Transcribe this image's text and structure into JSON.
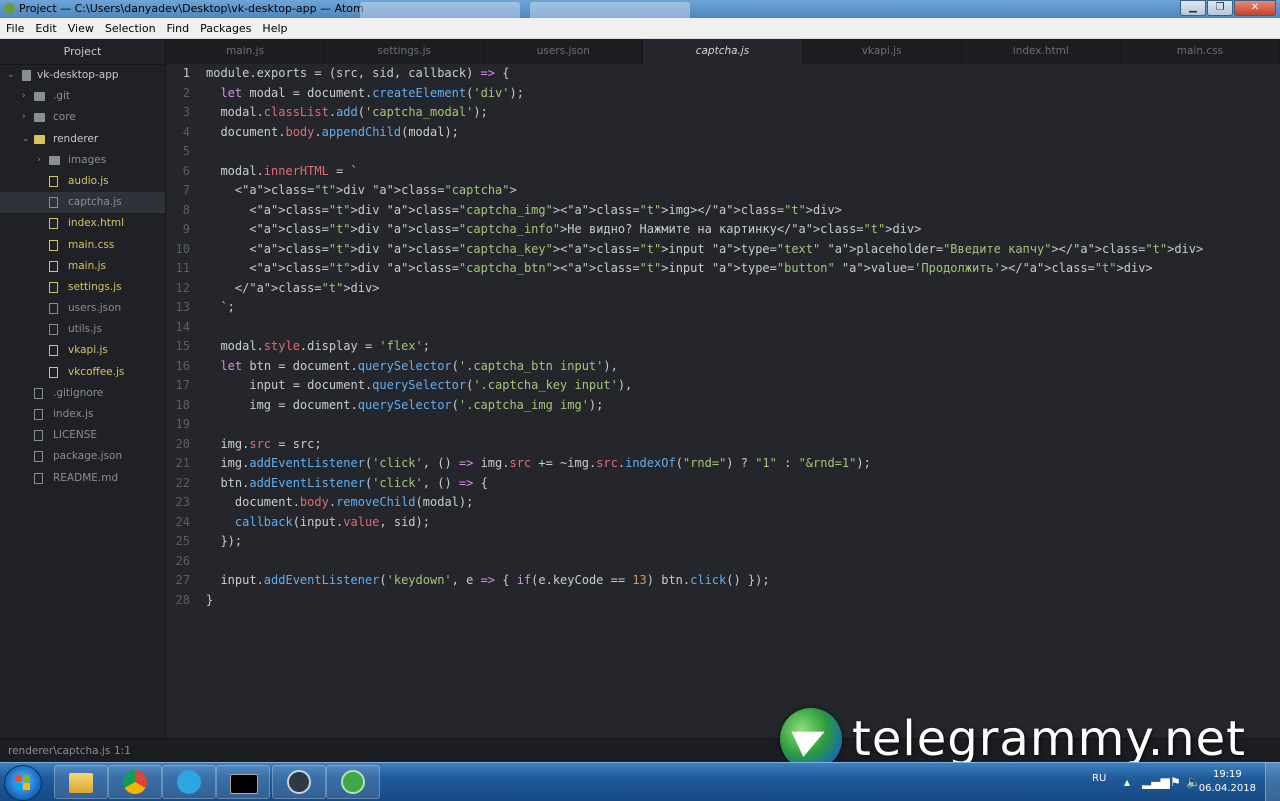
{
  "window": {
    "title": "Project — C:\\Users\\danyadev\\Desktop\\vk-desktop-app — Atom"
  },
  "menu": [
    "File",
    "Edit",
    "View",
    "Selection",
    "Find",
    "Packages",
    "Help"
  ],
  "tree": {
    "header": "Project",
    "root": "vk-desktop-app",
    "items": [
      {
        "label": ".git",
        "depth": 1,
        "type": "folder",
        "open": false
      },
      {
        "label": "core",
        "depth": 1,
        "type": "folder",
        "open": false
      },
      {
        "label": "renderer",
        "depth": 1,
        "type": "folder",
        "open": true
      },
      {
        "label": "images",
        "depth": 2,
        "type": "folder",
        "open": false
      },
      {
        "label": "audio.js",
        "depth": 2,
        "type": "file",
        "modified": true
      },
      {
        "label": "captcha.js",
        "depth": 2,
        "type": "file",
        "selected": true
      },
      {
        "label": "index.html",
        "depth": 2,
        "type": "file",
        "modified": true
      },
      {
        "label": "main.css",
        "depth": 2,
        "type": "file",
        "modified": true
      },
      {
        "label": "main.js",
        "depth": 2,
        "type": "file",
        "modified": true
      },
      {
        "label": "settings.js",
        "depth": 2,
        "type": "file",
        "modified": true
      },
      {
        "label": "users.json",
        "depth": 2,
        "type": "file"
      },
      {
        "label": "utils.js",
        "depth": 2,
        "type": "file"
      },
      {
        "label": "vkapi.js",
        "depth": 2,
        "type": "file",
        "modified": true
      },
      {
        "label": "vkcoffee.js",
        "depth": 2,
        "type": "file",
        "modified": true
      },
      {
        "label": ".gitignore",
        "depth": 1,
        "type": "file"
      },
      {
        "label": "index.js",
        "depth": 1,
        "type": "file"
      },
      {
        "label": "LICENSE",
        "depth": 1,
        "type": "file"
      },
      {
        "label": "package.json",
        "depth": 1,
        "type": "file"
      },
      {
        "label": "README.md",
        "depth": 1,
        "type": "file"
      }
    ]
  },
  "tabs": [
    {
      "label": "main.js"
    },
    {
      "label": "settings.js"
    },
    {
      "label": "users.json"
    },
    {
      "label": "captcha.js",
      "active": true
    },
    {
      "label": "vkapi.js"
    },
    {
      "label": "index.html"
    },
    {
      "label": "main.css"
    }
  ],
  "editor": {
    "current_line": 1,
    "lines": [
      "module.exports = (src, sid, callback) => {",
      "  let modal = document.createElement('div');",
      "  modal.classList.add('captcha_modal');",
      "  document.body.appendChild(modal);",
      "",
      "  modal.innerHTML = `",
      "    <div class=\"captcha\">",
      "      <div class=\"captcha_img\"><img></div>",
      "      <div class=\"captcha_info\">Не видно? Нажмите на картинку</div>",
      "      <div class=\"captcha_key\"><input type=\"text\" placeholder=\"Введите капчу\"></div>",
      "      <div class=\"captcha_btn\"><input type=\"button\" value='Продолжить'></div>",
      "    </div>",
      "  `;",
      "",
      "  modal.style.display = 'flex';",
      "  let btn = document.querySelector('.captcha_btn input'),",
      "      input = document.querySelector('.captcha_key input'),",
      "      img = document.querySelector('.captcha_img img');",
      "",
      "  img.src = src;",
      "  img.addEventListener('click', () => img.src += ~img.src.indexOf(\"rnd=\") ? \"1\" : \"&rnd=1\");",
      "  btn.addEventListener('click', () => {",
      "    document.body.removeChild(modal);",
      "    callback(input.value, sid);",
      "  });",
      "",
      "  input.addEventListener('keydown', e => { if(e.keyCode == 13) btn.click() });",
      "}"
    ]
  },
  "status": {
    "path": "renderer\\captcha.js",
    "position": "1:1"
  },
  "watermark": {
    "text": "telegrammy.net"
  },
  "taskbar": {
    "apps": [
      "explorer",
      "chrome",
      "telegram",
      "cmd",
      "atom-dev",
      "atom"
    ],
    "lang": "RU",
    "time": "19:19",
    "date": "06.04.2018"
  },
  "colors": {
    "keyword": "#d98de8",
    "string": "#a3c578",
    "function": "#61afef",
    "tag": "#e06c75",
    "attr": "#d19a66",
    "modified_file": "#d8c25e"
  }
}
